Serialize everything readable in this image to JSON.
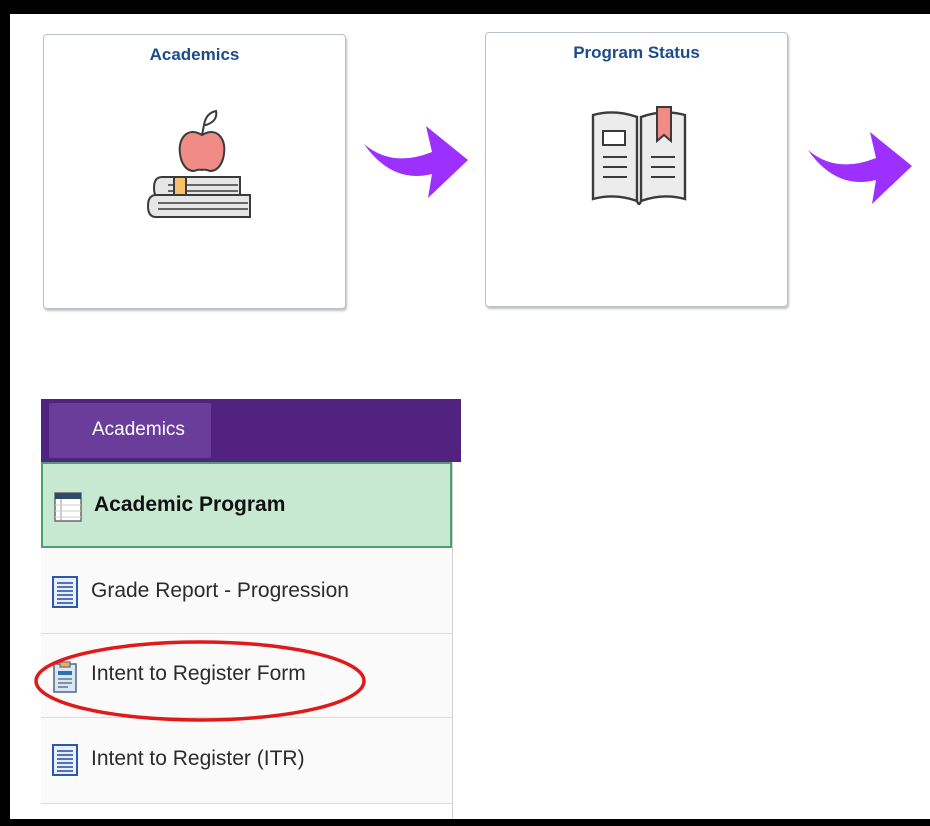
{
  "tiles": [
    {
      "title": "Academics",
      "icon": "apple-on-books-icon"
    },
    {
      "title": "Program Status",
      "icon": "open-book-icon"
    }
  ],
  "menu": {
    "header_label": "Academics",
    "items": [
      {
        "label": "Academic Program",
        "icon": "table-icon",
        "active": true
      },
      {
        "label": "Grade Report - Progression",
        "icon": "document-icon",
        "active": false
      },
      {
        "label": "Intent to Register Form",
        "icon": "form-clipboard-icon",
        "active": false,
        "highlighted": true
      },
      {
        "label": "Intent to Register (ITR)",
        "icon": "document-icon",
        "active": false
      }
    ]
  },
  "colors": {
    "tile_title": "#1d4c8a",
    "arrow": "#9b30ff",
    "menu_header": "#522280",
    "active_item_bg": "#c7e8d1",
    "highlight_ring": "#e01a1a"
  }
}
